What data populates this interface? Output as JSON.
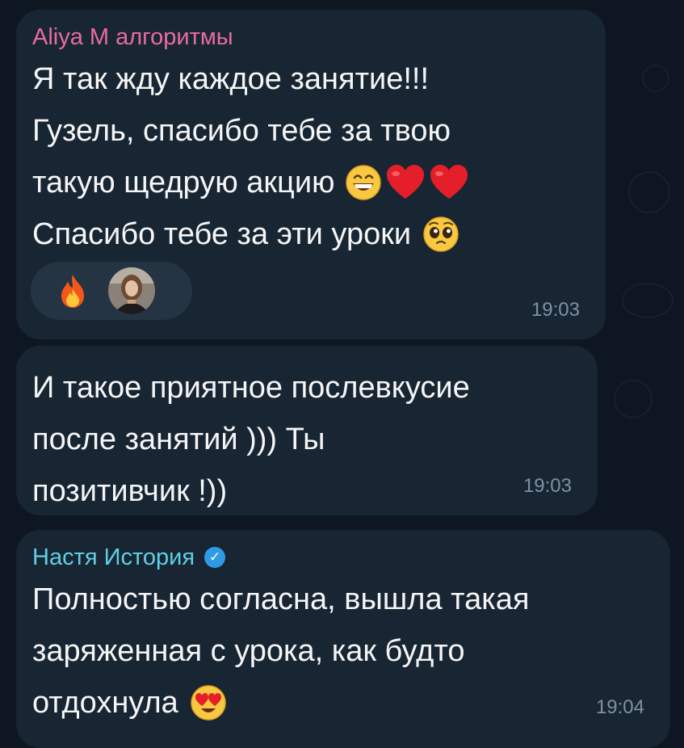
{
  "messages": [
    {
      "sender": "Aliya M алгоритмы",
      "lines": [
        "Я так жду каждое занятие!!!",
        "Гузель, спасибо тебе за твою",
        "такую щедрую акцию",
        "Спасибо тебе за эти уроки"
      ],
      "emojis": [
        "grinning-face-icon",
        "red-heart-icon",
        "red-heart-icon",
        "pleading-face-icon"
      ],
      "reactions": [
        "fire-icon",
        "reactor-avatar"
      ],
      "time": "19:03"
    },
    {
      "lines": [
        "И такое приятное послевкусие",
        "после занятий ))) Ты",
        "позитивчик !))"
      ],
      "time": "19:03"
    },
    {
      "sender": "Настя История",
      "sender_badge": "verified-badge-icon",
      "lines": [
        "Полностью согласна, вышла такая",
        "заряженная с урока, как будто",
        "отдохнула"
      ],
      "emojis": [
        "heart-eyes-face-icon"
      ],
      "time": "19:04"
    }
  ],
  "colors": {
    "background": "#0e1621",
    "bubble": "#182533",
    "reaction_pill": "#243443",
    "sender_1": "#e86c9e",
    "sender_3": "#5fd0e6",
    "text": "#f5f5f5",
    "time": "#7f91a4",
    "verified": "#2f9be6"
  }
}
